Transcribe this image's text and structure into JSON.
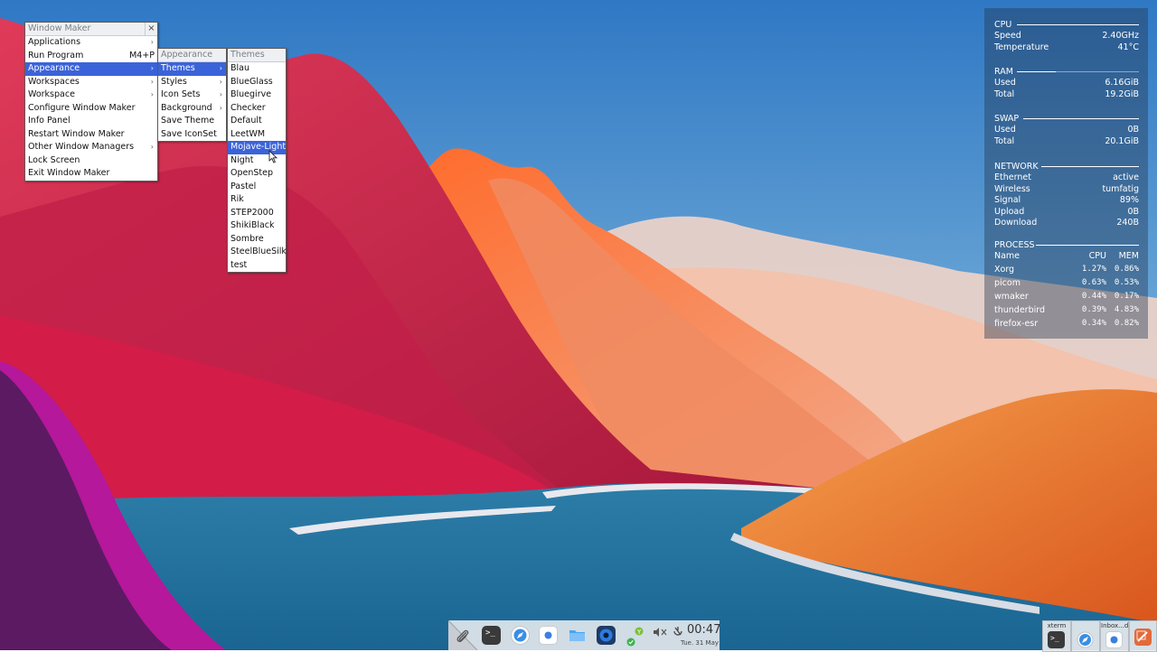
{
  "root_menu": {
    "title": "Window Maker",
    "close_glyph": "×",
    "items": [
      {
        "label": "Applications"
      },
      {
        "label": "Run Program",
        "shortcut": "M4+P"
      },
      {
        "label": "Appearance"
      },
      {
        "label": "Workspaces"
      },
      {
        "label": "Workspace"
      },
      {
        "label": "Configure Window Maker"
      },
      {
        "label": "Info Panel"
      },
      {
        "label": "Restart Window Maker"
      },
      {
        "label": "Other Window Managers"
      },
      {
        "label": "Lock Screen"
      },
      {
        "label": "Exit Window Maker"
      }
    ]
  },
  "appearance_menu": {
    "title": "Appearance",
    "items": [
      {
        "label": "Themes"
      },
      {
        "label": "Styles"
      },
      {
        "label": "Icon Sets"
      },
      {
        "label": "Background"
      },
      {
        "label": "Save Theme"
      },
      {
        "label": "Save IconSet"
      }
    ]
  },
  "themes_menu": {
    "title": "Themes",
    "items": [
      {
        "label": "Blau"
      },
      {
        "label": "BlueGlass"
      },
      {
        "label": "Bluegirve"
      },
      {
        "label": "Checker"
      },
      {
        "label": "Default"
      },
      {
        "label": "LeetWM"
      },
      {
        "label": "Mojave-Light"
      },
      {
        "label": "Night"
      },
      {
        "label": "OpenStep"
      },
      {
        "label": "Pastel"
      },
      {
        "label": "Rik"
      },
      {
        "label": "STEP2000"
      },
      {
        "label": "ShikiBlack"
      },
      {
        "label": "Sombre"
      },
      {
        "label": "SteelBlueSilk"
      },
      {
        "label": "test"
      }
    ]
  },
  "conky": {
    "cpu": {
      "title": "CPU",
      "speed_label": "Speed",
      "speed": "2.40GHz",
      "temp_label": "Temperature",
      "temp": "41°C"
    },
    "ram": {
      "title": "RAM",
      "used_label": "Used",
      "used": "6.16GiB",
      "total_label": "Total",
      "total": "19.2GiB",
      "usage_fraction": 0.32
    },
    "swap": {
      "title": "SWAP",
      "used_label": "Used",
      "used": "0B",
      "total_label": "Total",
      "total": "20.1GiB"
    },
    "network": {
      "title": "NETWORK",
      "rows": [
        {
          "label": "Ethernet",
          "value": "active"
        },
        {
          "label": "Wireless",
          "value": "tumfatig"
        },
        {
          "label": "Signal",
          "value": "89%"
        },
        {
          "label": "Upload",
          "value": "0B"
        },
        {
          "label": "Download",
          "value": "240B"
        }
      ]
    },
    "process": {
      "title": "PROCESS",
      "col_name": "Name",
      "col_cpu": "CPU",
      "col_mem": "MEM",
      "rows": [
        {
          "name": "Xorg",
          "cpu": "1.27%",
          "mem": "0.86%"
        },
        {
          "name": "picom",
          "cpu": "0.63%",
          "mem": "0.53%"
        },
        {
          "name": "wmaker",
          "cpu": "0.44%",
          "mem": "0.17%"
        },
        {
          "name": "thunderbird",
          "cpu": "0.39%",
          "mem": "4.83%"
        },
        {
          "name": "firefox-esr",
          "cpu": "0.34%",
          "mem": "0.82%"
        }
      ]
    }
  },
  "dock": {
    "clock": "00:47",
    "date": "Tue. 31 May",
    "icons": [
      "paperclip-icon",
      "terminal-icon",
      "safari-compass-icon",
      "dot-app-icon",
      "folder-icon",
      "blue-circle-app-icon",
      "status-check-icon",
      "volume-icon",
      "power-icon"
    ]
  },
  "tray": [
    {
      "label": "xterm",
      "icon": "terminal-icon"
    },
    {
      "label": "",
      "icon": "safari-compass-icon"
    },
    {
      "label": "Inbox...d",
      "icon": "dot-app-icon"
    },
    {
      "label": "",
      "icon": "notes-app-icon"
    }
  ]
}
